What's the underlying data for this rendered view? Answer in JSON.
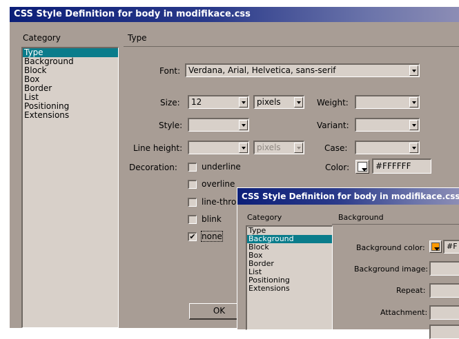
{
  "main_dialog": {
    "title": "CSS Style Definition for body in modifikace.css",
    "category_header": "Category",
    "panel_header": "Type",
    "categories": [
      "Type",
      "Background",
      "Block",
      "Box",
      "Border",
      "List",
      "Positioning",
      "Extensions"
    ],
    "selected_category": "Type",
    "font": {
      "label": "Font:",
      "value": "Verdana, Arial, Helvetica, sans-serif"
    },
    "size": {
      "label": "Size:",
      "value": "12",
      "unit": "pixels"
    },
    "weight": {
      "label": "Weight:",
      "value": ""
    },
    "style": {
      "label": "Style:",
      "value": ""
    },
    "variant": {
      "label": "Variant:",
      "value": ""
    },
    "line_height": {
      "label": "Line height:",
      "value": "",
      "unit": "pixels"
    },
    "case": {
      "label": "Case:",
      "value": ""
    },
    "color": {
      "label": "Color:",
      "value": "#FFFFFF",
      "swatch": "#ffffff"
    },
    "decoration": {
      "label": "Decoration:",
      "options": [
        {
          "label": "underline",
          "checked": false
        },
        {
          "label": "overline",
          "checked": false
        },
        {
          "label": "line-thro",
          "checked": false
        },
        {
          "label": "blink",
          "checked": false
        },
        {
          "label": "none",
          "checked": true
        }
      ]
    },
    "ok_label": "OK",
    "check_mark": "✔"
  },
  "overlay_dialog": {
    "title": "CSS Style Definition for body in modifikace.css",
    "category_header": "Category",
    "panel_header": "Background",
    "categories": [
      "Type",
      "Background",
      "Block",
      "Box",
      "Border",
      "List",
      "Positioning",
      "Extensions"
    ],
    "selected_category": "Background",
    "bg_color": {
      "label": "Background color:",
      "value": "#F",
      "swatch": "#ff9900"
    },
    "bg_image": {
      "label": "Background image:",
      "value": ""
    },
    "repeat": {
      "label": "Repeat:",
      "value": ""
    },
    "attachment": {
      "label": "Attachment:",
      "value": ""
    }
  },
  "colors": {
    "dialog_bg": "#a89d95",
    "titlebar": "#0c1f78",
    "selection": "#0a7c8b"
  }
}
